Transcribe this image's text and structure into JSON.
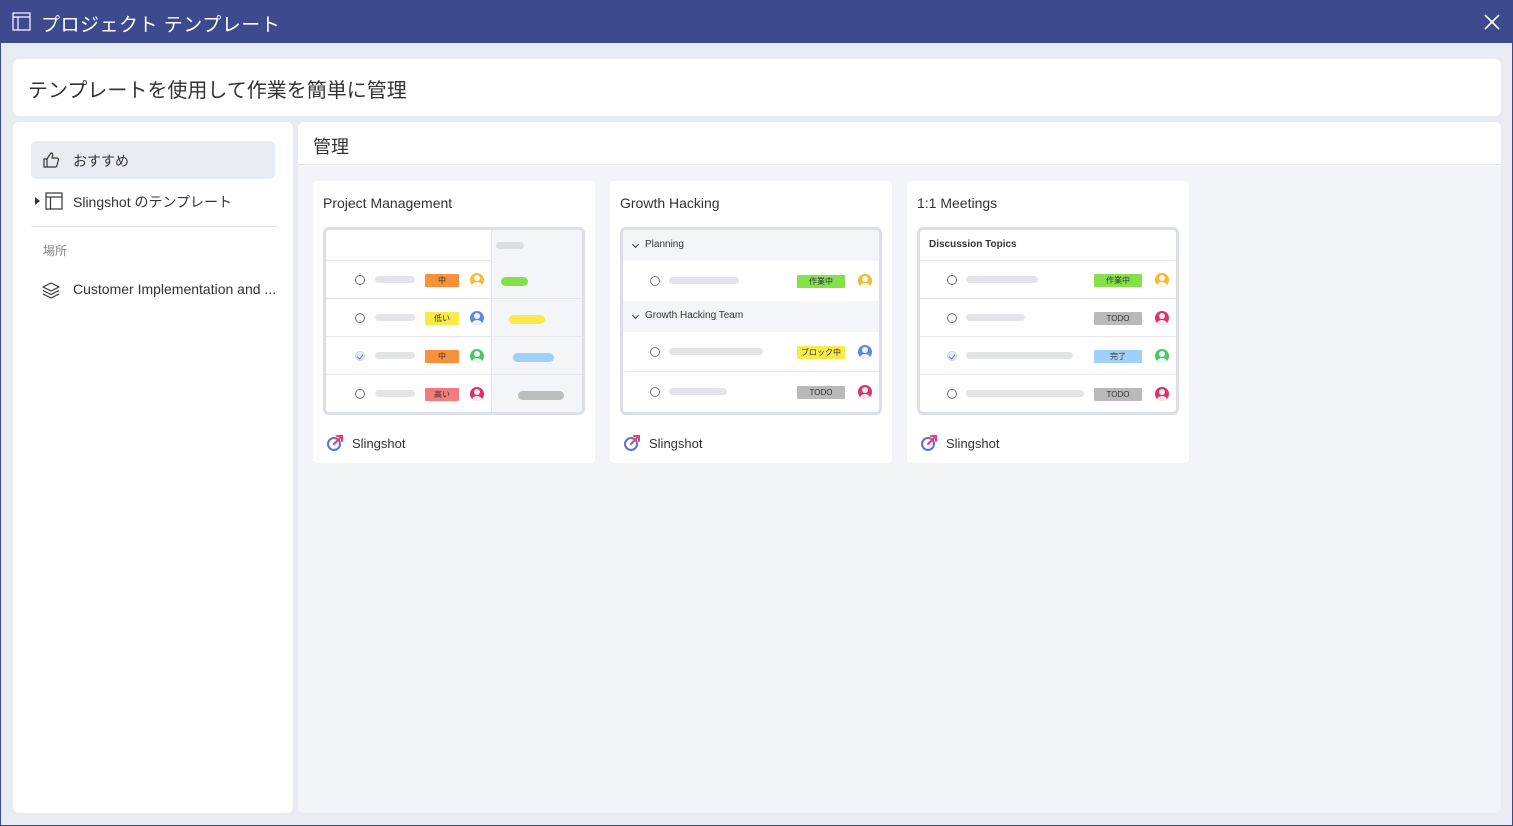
{
  "window": {
    "title": "プロジェクト テンプレート",
    "icon": "template-icon",
    "close_icon": "close-icon"
  },
  "header": {
    "text": "テンプレートを使用して作業を簡単に管理"
  },
  "sidebar": {
    "items": [
      {
        "label": "おすすめ",
        "icon": "thumbs-up-icon",
        "active": true
      },
      {
        "label": "Slingshot のテンプレート",
        "icon": "template-icon",
        "expandable": true
      }
    ],
    "section_label": "場所",
    "places": [
      {
        "label": "Customer Implementation and ...",
        "icon": "layers-icon"
      }
    ]
  },
  "main": {
    "title": "管理",
    "cards": [
      {
        "title": "Project Management",
        "brand": "Slingshot",
        "tags": [
          "中",
          "低い",
          "中",
          "高い"
        ]
      },
      {
        "title": "Growth Hacking",
        "brand": "Slingshot",
        "groups": [
          "Planning",
          "Growth Hacking Team"
        ],
        "tags": [
          "作業中",
          "ブロック中",
          "TODO"
        ]
      },
      {
        "title": "1:1 Meetings",
        "brand": "Slingshot",
        "header": "Discussion Topics",
        "tags": [
          "作業中",
          "TODO",
          "完了",
          "TODO"
        ]
      }
    ]
  },
  "colors": {
    "titlebar": "#3e4a8e",
    "tag_orange": "#f7923a",
    "tag_yellow": "#f9e94a",
    "tag_red": "#f27b7b",
    "tag_green": "#86e04b",
    "tag_gray": "#b9b9b9",
    "tag_blue": "#9fd0f7"
  }
}
